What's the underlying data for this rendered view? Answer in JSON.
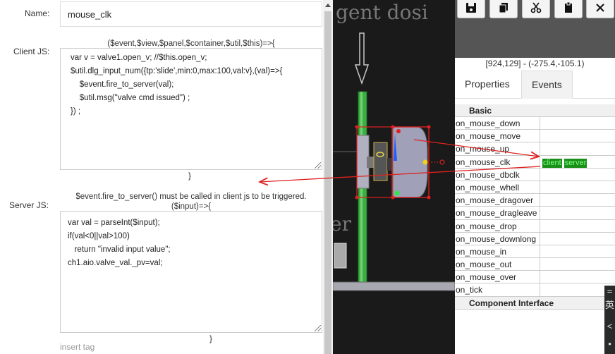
{
  "form": {
    "name_label": "Name:",
    "name_value": "mouse_clk",
    "client_label": "Client JS:",
    "client_signature": "($event,$view,$panel,$container,$util,$this)=>{",
    "client_code": [
      "var v = valve1.open_v; //$this.open_v;",
      "$util.dlg_input_num({tp:'slide',min:0,max:100,val:v},(val)=>{",
      "    $event.fire_to_server(val);",
      "    $util.msg(\"valve cmd issued\") ;",
      "}) ;"
    ],
    "client_close": "}",
    "server_label": "Server JS:",
    "server_note": "$event.fire_to_server() must be called in client js to be triggered.",
    "server_signature": "($input)=>{",
    "server_code": [
      "var val = parseInt($input);",
      "if(val<0||val>100)",
      "   return \"invalid input value\";",
      "ch1.aio.valve_val._pv=val;"
    ],
    "server_close": "}",
    "insert_tag": "insert tag"
  },
  "canvas": {
    "bg_text_top": "gent dosi",
    "bg_text_mid": "er",
    "accent_red": "#e02020",
    "pipe_green": "#3cb043"
  },
  "toolbar": {
    "buttons": [
      "save-icon",
      "copy-icon",
      "cut-icon",
      "paste-icon",
      "close-icon"
    ]
  },
  "right": {
    "coords": "[924,129] - (-275.4,-105.1)",
    "tabs": [
      "Properties",
      "Events"
    ],
    "active_tab": "Events",
    "section_basic": "Basic",
    "events": [
      {
        "name": "on_mouse_down",
        "tags": []
      },
      {
        "name": "on_mouse_move",
        "tags": []
      },
      {
        "name": "on_mouse_up",
        "tags": []
      },
      {
        "name": "on_mouse_clk",
        "tags": [
          "client",
          "server"
        ]
      },
      {
        "name": "on_mouse_dbclk",
        "tags": []
      },
      {
        "name": "on_mouse_whell",
        "tags": []
      },
      {
        "name": "on_mouse_dragover",
        "tags": []
      },
      {
        "name": "on_mouse_dragleave",
        "tags": []
      },
      {
        "name": "on_mouse_drop",
        "tags": []
      },
      {
        "name": "on_mouse_downlong",
        "tags": []
      },
      {
        "name": "on_mouse_in",
        "tags": []
      },
      {
        "name": "on_mouse_out",
        "tags": []
      },
      {
        "name": "on_mouse_over",
        "tags": []
      },
      {
        "name": "on_tick",
        "tags": []
      }
    ],
    "section_component": "Component Interface"
  },
  "corner": [
    "=",
    "英",
    "<",
    "•"
  ]
}
